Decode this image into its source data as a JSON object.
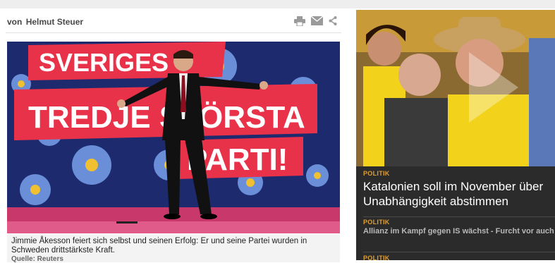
{
  "article": {
    "author_prefix": "von",
    "author_name": "Helmut Steuer",
    "tools": [
      "print-icon",
      "mail-icon",
      "share-icon"
    ],
    "photo": {
      "banner_line1": "SVERIGES",
      "banner_line2": "TREDJE STÖRSTA",
      "banner_line3": "PARTI!"
    },
    "caption": "Jimmie Åkesson feiert sich selbst und seinen Erfolg: Er und seine Partei wurden in Schweden drittstärkste Kraft.",
    "source": "Quelle: Reuters"
  },
  "teaser": {
    "kicker": "POLITIK",
    "headline": "Katalonien soll im November über Unabhängigkeit abstimmen",
    "items": [
      {
        "kicker": "POLITIK",
        "title": "Allianz im Kampf gegen IS wächst - Furcht vor auch"
      },
      {
        "kicker": "POLITIK"
      }
    ]
  },
  "colors": {
    "kicker": "#e0a030",
    "teaser_bg": "#2b2b2b",
    "banner_red": "#e8324a",
    "banner_blue": "#1d2a6e"
  }
}
